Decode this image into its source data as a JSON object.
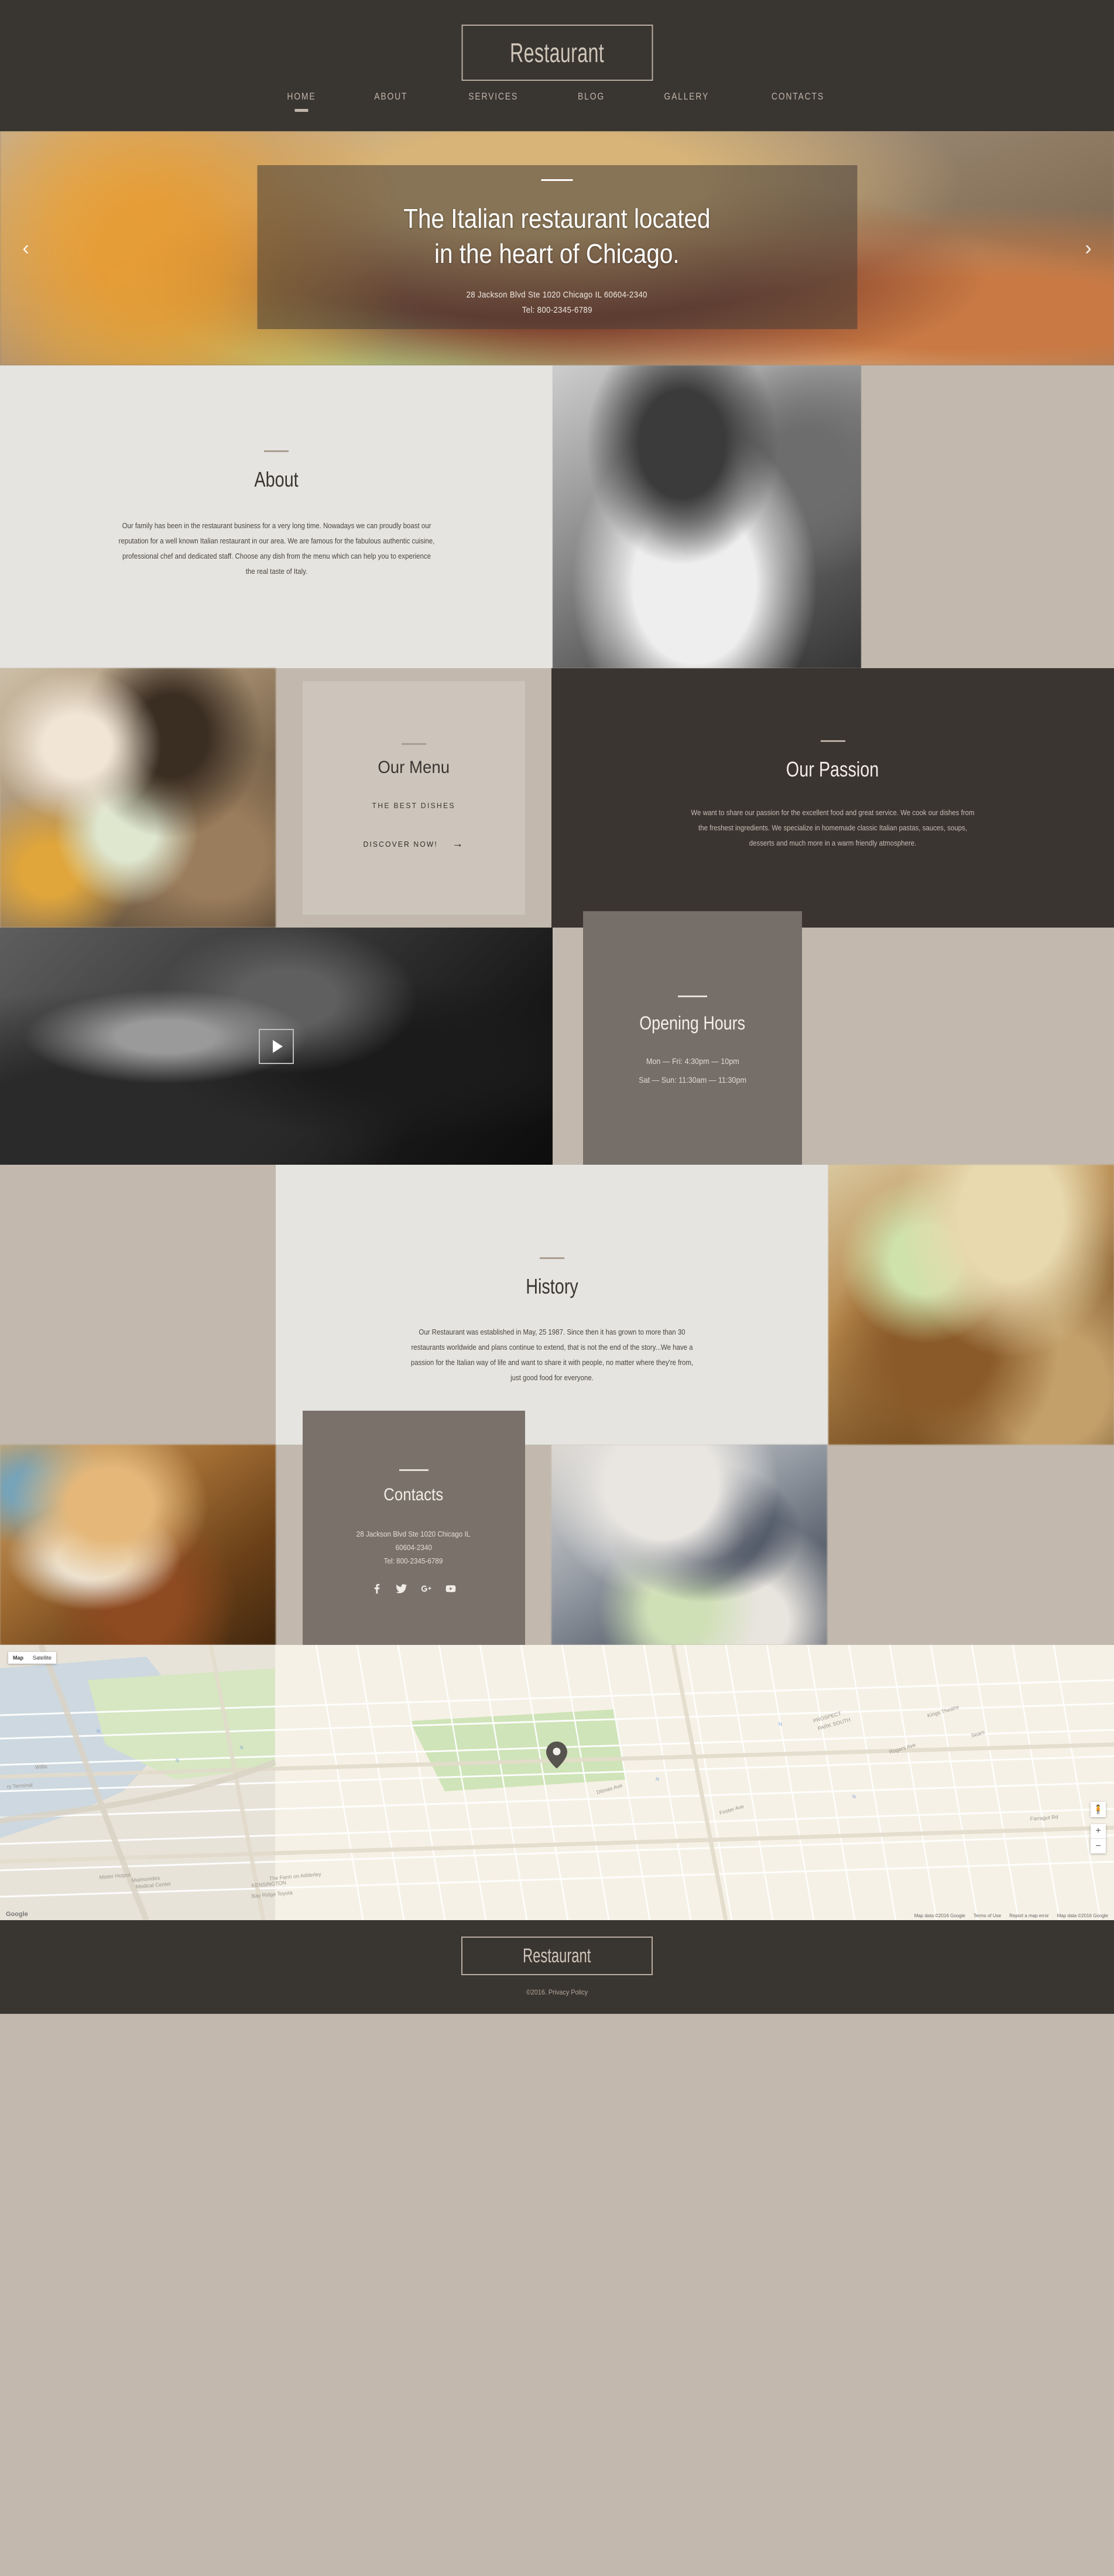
{
  "header": {
    "logo": "Restaurant",
    "nav": [
      {
        "label": "HOME",
        "active": true
      },
      {
        "label": "ABOUT",
        "active": false
      },
      {
        "label": "SERVICES",
        "active": false
      },
      {
        "label": "BLOG",
        "active": false
      },
      {
        "label": "GALLERY",
        "active": false
      },
      {
        "label": "CONTACTS",
        "active": false
      }
    ]
  },
  "hero": {
    "title_line1": "The Italian restaurant located",
    "title_line2": "in the heart of Chicago.",
    "address": "28 Jackson Blvd Ste 1020 Chicago IL 60604-2340",
    "tel": "Tel: 800-2345-6789",
    "prev": "‹",
    "next": "›"
  },
  "about": {
    "title": "About",
    "body": "Our family has been in the restaurant business for a very long time. Nowadays we can proudly boast our reputation for a well known Italian restaurant in our area. We are famous for the fabulous authentic cuisine, professional chef and dedicated staff. Choose any dish from the menu which can help you to experience the real taste of Italy."
  },
  "menu": {
    "title": "Our Menu",
    "subtitle": "THE BEST DISHES",
    "cta": "DISCOVER NOW!",
    "cta_arrow": "→"
  },
  "passion": {
    "title": "Our Passion",
    "body": "We want to share our passion for the excellent food and great service. We cook our dishes from the freshest ingredients. We specialize in homemade classic Italian pastas, sauces, soups, desserts and much more in a warm friendly atmosphere."
  },
  "hours": {
    "title": "Opening Hours",
    "line1": "Mon — Fri: 4:30pm — 10pm",
    "line2": "Sat — Sun: 11:30am — 11:30pm"
  },
  "history": {
    "title": "History",
    "body": "Our Restaurant was established in May, 25 1987. Since then it has grown to more than 30 restaurants worldwide and plans continue to extend, that is not the end of the story...We have a passion for the Italian way of life and want to share it with people, no matter where they're from, just good food for everyone."
  },
  "contacts": {
    "title": "Contacts",
    "address_line1": "28 Jackson Blvd Ste 1020 Chicago IL",
    "address_line2": "60604-2340",
    "tel": "Tel: 800-2345-6789",
    "socials": [
      "facebook-icon",
      "twitter-icon",
      "google-plus-icon",
      "youtube-icon"
    ]
  },
  "map": {
    "type_map": "Map",
    "type_satellite": "Satellite",
    "zoom_in": "+",
    "zoom_out": "−",
    "pegman": "🧍",
    "google_label": "Google",
    "attrib_mapdata": "Map data ©2016 Google",
    "attrib_terms": "Terms of Use",
    "attrib_report": "Report a map error",
    "attrib_mapdata2": "Map data ©2016 Google"
  },
  "footer": {
    "logo": "Restaurant",
    "copyright": "©2016. Privacy Policy"
  },
  "colors": {
    "dark": "#393531",
    "beige": "#c2b8ad",
    "light_gray": "#e5e4e1",
    "card_gray": "#766e68",
    "accent_rule": "#b9ada0"
  }
}
